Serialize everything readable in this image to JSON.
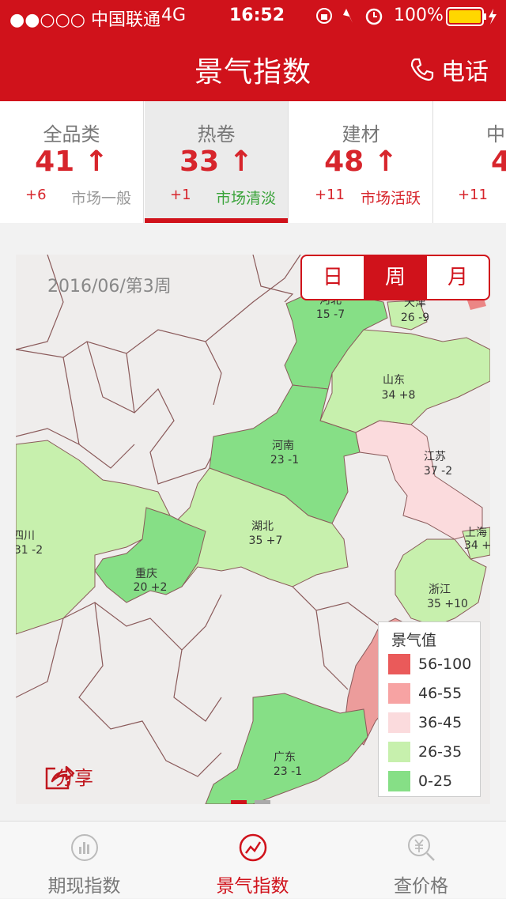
{
  "status_bar": {
    "carrier": "●●○○○ 中国联通",
    "network": "4G",
    "time": "16:52",
    "battery": "100%"
  },
  "nav": {
    "title": "景气指数",
    "phone_label": "电话"
  },
  "tabs": [
    {
      "name": "全品类",
      "value": "41 ↑",
      "change": "+6",
      "state": "市场一般",
      "state_color": "#999999"
    },
    {
      "name": "热卷",
      "value": "33 ↑",
      "change": "+1",
      "state": "市场清淡",
      "state_color": "#3aa33a"
    },
    {
      "name": "建材",
      "value": "48 ↑",
      "change": "+11",
      "state": "市场活跃",
      "state_color": "#d7252c"
    },
    {
      "name": "中",
      "value": "4",
      "change": "+11",
      "state": "",
      "state_color": "#999999"
    }
  ],
  "map": {
    "date": "2016/06/第3周",
    "period_options": [
      "日",
      "周",
      "月"
    ],
    "period_selected": "周",
    "regions": [
      {
        "name": "河北",
        "value": "15 -7"
      },
      {
        "name": "天津",
        "value": "26 -9"
      },
      {
        "name": "山东",
        "value": "34 +8"
      },
      {
        "name": "河南",
        "value": "23 -1"
      },
      {
        "name": "江苏",
        "value": "37 -2"
      },
      {
        "name": "四川",
        "value": "31 -2"
      },
      {
        "name": "湖北",
        "value": "35 +7"
      },
      {
        "name": "上海",
        "value": "34 +"
      },
      {
        "name": "重庆",
        "value": "20 +2"
      },
      {
        "name": "浙江",
        "value": "35 +10"
      },
      {
        "name": "广东",
        "value": "23 -1"
      }
    ],
    "share_label": "分享"
  },
  "legend": {
    "title": "景气值",
    "items": [
      {
        "label": "56-100",
        "color": "#ea5a5a"
      },
      {
        "label": "46-55",
        "color": "#f7a3a3"
      },
      {
        "label": "36-45",
        "color": "#fbdbdd"
      },
      {
        "label": "26-35",
        "color": "#c7f0ad"
      },
      {
        "label": "0-25",
        "color": "#86df86"
      }
    ]
  },
  "bottom_tabs": [
    {
      "label": "期现指数",
      "active": false
    },
    {
      "label": "景气指数",
      "active": true
    },
    {
      "label": "查价格",
      "active": false
    }
  ],
  "colors": {
    "brand": "#d0121b",
    "inactive": "#777777"
  }
}
